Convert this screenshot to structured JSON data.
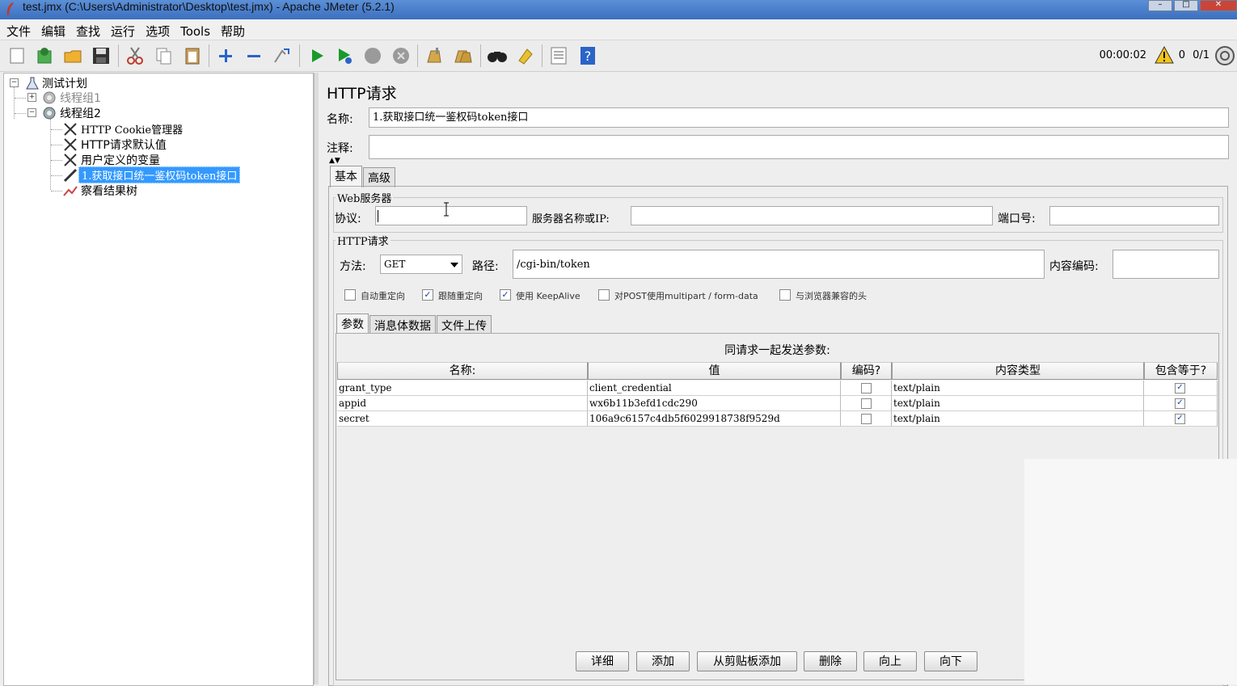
{
  "window": {
    "title": "test.jmx (C:\\Users\\Administrator\\Desktop\\test.jmx) - Apache JMeter (5.2.1)"
  },
  "menu": [
    "文件",
    "编辑",
    "查找",
    "运行",
    "选项",
    "Tools",
    "帮助"
  ],
  "status": {
    "timer": "00:00:02",
    "warnings": "0",
    "threads": "0/1"
  },
  "tree": {
    "root": "测试计划",
    "group1": "线程组1",
    "group2": "线程组2",
    "children": [
      "HTTP Cookie管理器",
      "HTTP请求默认值",
      "用户定义的变量",
      "1.获取接口统一鉴权码token接口",
      "察看结果树"
    ]
  },
  "panel": {
    "title": "HTTP请求",
    "name_label": "名称:",
    "name_value": "1.获取接口统一鉴权码token接口",
    "comment_label": "注释:",
    "comment_value": "",
    "tabs": [
      "基本",
      "高级"
    ],
    "web_server": {
      "title": "Web服务器",
      "protocol_label": "协议:",
      "protocol_value": "",
      "server_label": "服务器名称或IP:",
      "server_value": "",
      "port_label": "端口号:",
      "port_value": ""
    },
    "http_request": {
      "title": "HTTP请求",
      "method_label": "方法:",
      "method_value": "GET",
      "path_label": "路径:",
      "path_value": "/cgi-bin/token",
      "encoding_label": "内容编码:",
      "encoding_value": ""
    },
    "options": [
      {
        "label": "自动重定向",
        "checked": false
      },
      {
        "label": "跟随重定向",
        "checked": true
      },
      {
        "label": "使用 KeepAlive",
        "checked": true
      },
      {
        "label": "对POST使用multipart / form-data",
        "checked": false
      },
      {
        "label": "与浏览器兼容的头",
        "checked": false
      }
    ],
    "subtabs": [
      "参数",
      "消息体数据",
      "文件上传"
    ],
    "table": {
      "title": "同请求一起发送参数:",
      "headers": [
        "名称:",
        "值",
        "编码?",
        "内容类型",
        "包含等于?"
      ],
      "rows": [
        {
          "name": "grant_type",
          "value": "client_credential",
          "encode": false,
          "type": "text/plain",
          "include_eq": true
        },
        {
          "name": "appid",
          "value": "wx6b11b3efd1cdc290",
          "encode": false,
          "type": "text/plain",
          "include_eq": true
        },
        {
          "name": "secret",
          "value": "106a9c6157c4db5f6029918738f9529d",
          "encode": false,
          "type": "text/plain",
          "include_eq": true
        }
      ]
    },
    "buttons": [
      "详细",
      "添加",
      "从剪贴板添加",
      "删除",
      "向上",
      "向下"
    ]
  },
  "icons": [
    "new-icon",
    "templates-icon",
    "open-icon",
    "save-icon",
    "cut-icon",
    "copy-icon",
    "paste-icon",
    "expand-icon",
    "collapse-icon",
    "toggle-icon",
    "start-icon",
    "start-no-timers-icon",
    "stop-icon",
    "shutdown-icon",
    "clear-icon",
    "clear-all-icon",
    "search-icon",
    "reset-search-icon",
    "function-helper-icon",
    "help-icon"
  ]
}
